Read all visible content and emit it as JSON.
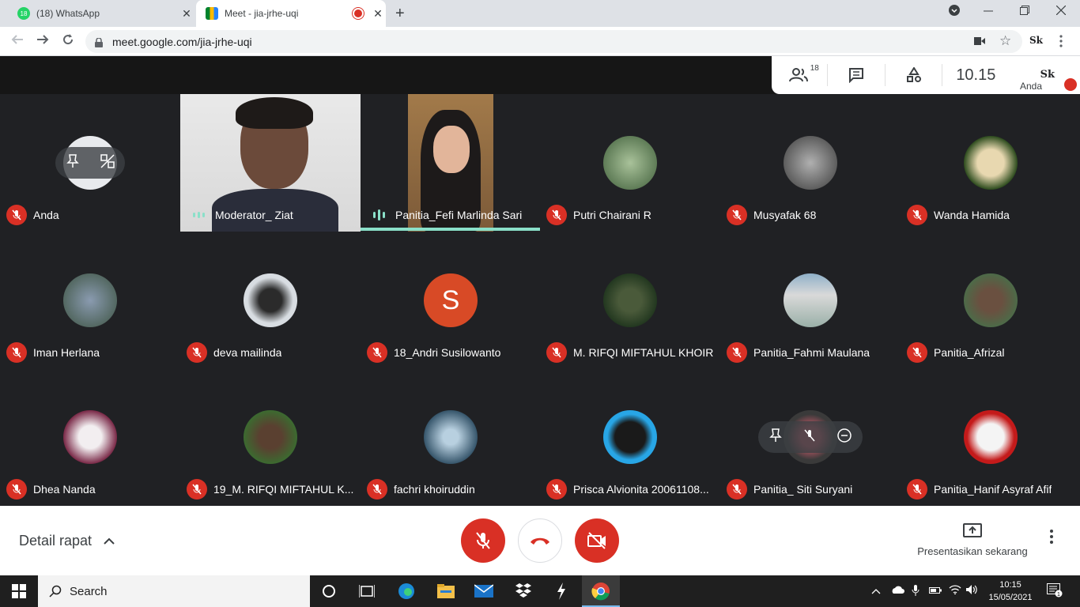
{
  "browser": {
    "tabs": [
      {
        "title": "(18) WhatsApp",
        "badge": "18",
        "close": "✕"
      },
      {
        "title": "Meet - jia-jrhe-uqi",
        "close": "✕"
      }
    ],
    "new_tab": "+",
    "url": "meet.google.com/jia-jrhe-uqi"
  },
  "meet": {
    "people_count": "18",
    "clock": "10.15",
    "self_label": "Anda",
    "self_logo": "Sk",
    "participants": [
      {
        "name": "Anda",
        "muted": true
      },
      {
        "name": "Moderator_ Ziat",
        "speaking": true
      },
      {
        "name": "Panitia_Fefi Marlinda Sari",
        "speaking": true
      },
      {
        "name": "Putri Chairani R",
        "muted": true
      },
      {
        "name": "Musyafak 68",
        "muted": true
      },
      {
        "name": "Wanda Hamida",
        "muted": true
      },
      {
        "name": "Iman Herlana",
        "muted": true
      },
      {
        "name": "deva mailinda",
        "muted": true
      },
      {
        "name": "18_Andri Susilowanto",
        "muted": true,
        "initial": "S"
      },
      {
        "name": "M. RIFQI MIFTAHUL KHOIR",
        "muted": true
      },
      {
        "name": "Panitia_Fahmi Maulana",
        "muted": true
      },
      {
        "name": "Panitia_Afrizal",
        "muted": true
      },
      {
        "name": "Dhea Nanda",
        "muted": true
      },
      {
        "name": "19_M. RIFQI MIFTAHUL K...",
        "muted": true
      },
      {
        "name": "fachri khoiruddin",
        "muted": true
      },
      {
        "name": "Prisca Alvionita 20061108...",
        "muted": true
      },
      {
        "name": "Panitia_ Siti Suryani",
        "muted": true
      },
      {
        "name": "Panitia_Hanif Asyraf Afif",
        "muted": true
      }
    ],
    "detail_label": "Detail rapat",
    "present_label": "Presentasikan sekarang"
  },
  "taskbar": {
    "search_label": "Search",
    "time": "10:15",
    "date": "15/05/2021",
    "notif_count": "1"
  },
  "colors": {
    "accent": "#8ae0c9",
    "mute_red": "#d93025",
    "meet_bg": "#202124"
  }
}
